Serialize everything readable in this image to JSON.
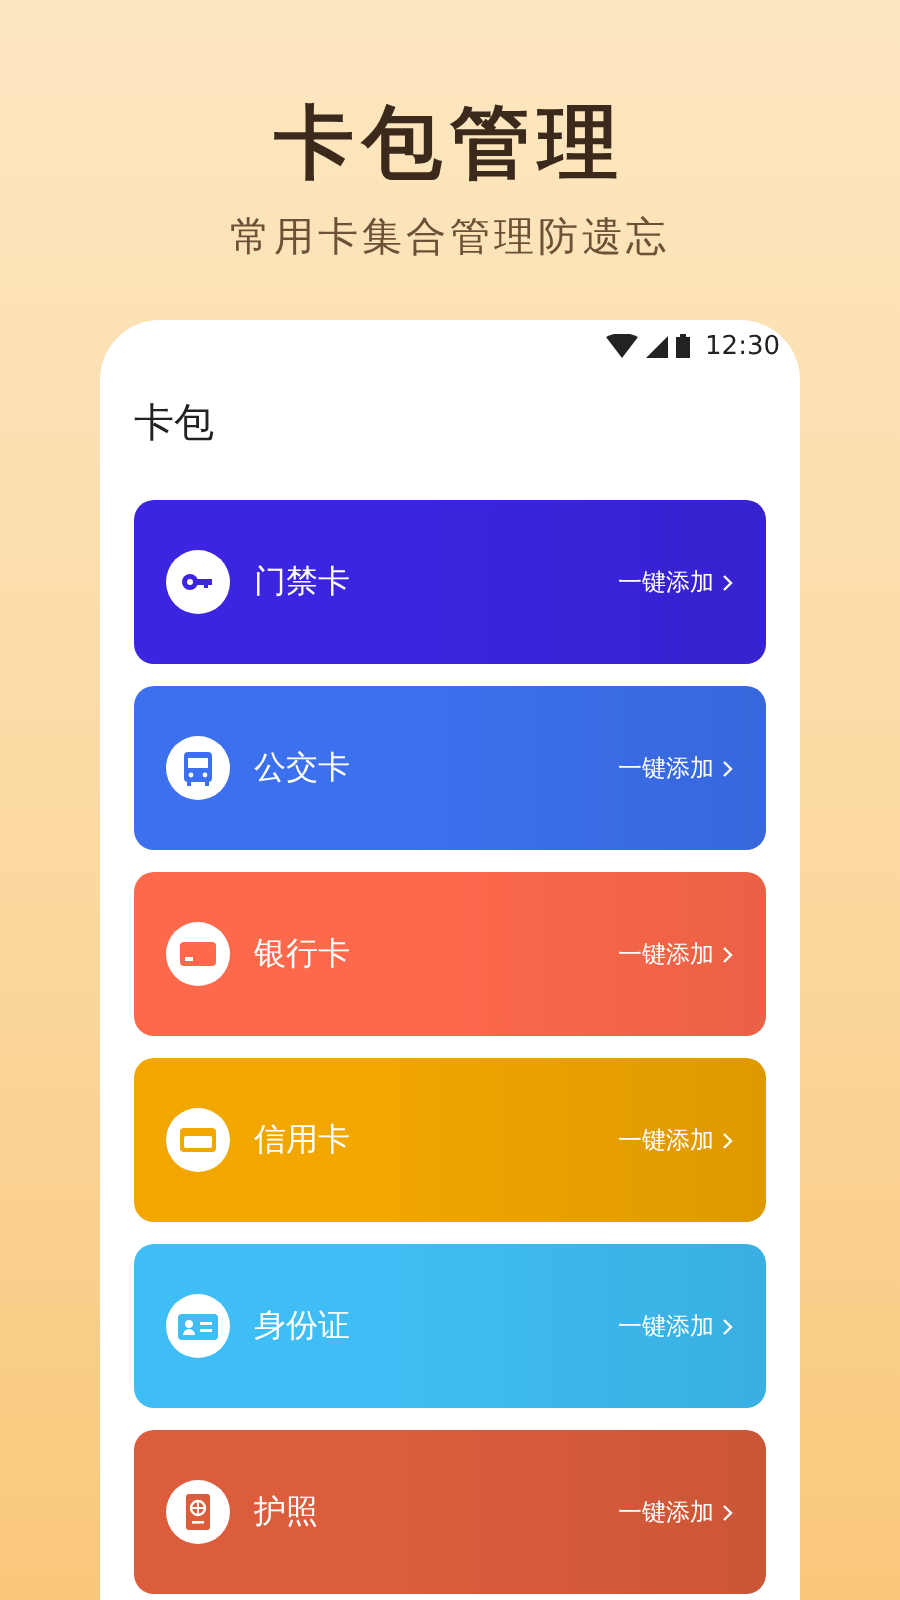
{
  "headline": "卡包管理",
  "subtitle": "常用卡集合管理防遗忘",
  "status_bar": {
    "time": "12:30"
  },
  "page_title": "卡包",
  "cards": [
    {
      "kind": "key",
      "label": "门禁卡",
      "action": "一键添加",
      "color": "#3b25e0"
    },
    {
      "kind": "bus",
      "label": "公交卡",
      "action": "一键添加",
      "color": "#3c70ee"
    },
    {
      "kind": "bank",
      "label": "银行卡",
      "action": "一键添加",
      "color": "#ff694b"
    },
    {
      "kind": "credit",
      "label": "信用卡",
      "action": "一键添加",
      "color": "#f1a600"
    },
    {
      "kind": "id",
      "label": "身份证",
      "action": "一键添加",
      "color": "#3ebef4"
    },
    {
      "kind": "passport",
      "label": "护照",
      "action": "一键添加",
      "color": "#dc5d3c"
    }
  ]
}
